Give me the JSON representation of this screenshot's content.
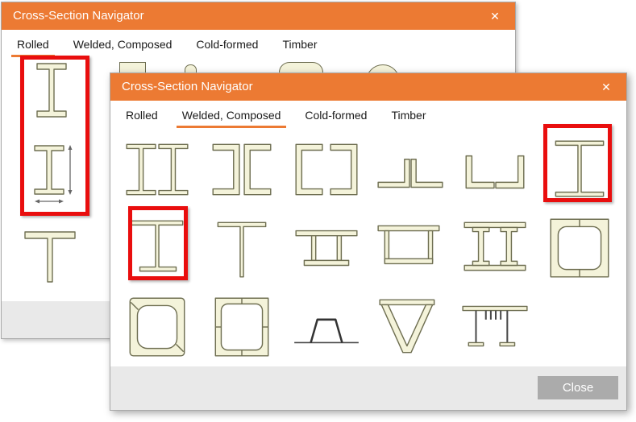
{
  "colors": {
    "titlebar": "#EC7A33",
    "tab_underline": "#EC7A33",
    "annotation": "#E90E0E",
    "shape_fill": "#F4F3DA",
    "shape_stroke": "#6F6F52",
    "dim_line": "#666666",
    "dark_line": "#4A4A4A",
    "footer_bg": "#E9E9E9",
    "close_button_bg": "#ABABAB"
  },
  "back_window": {
    "title": "Cross-Section Navigator",
    "close_icon": "✕",
    "tabs": [
      {
        "label": "Rolled",
        "selected": true
      },
      {
        "label": "Welded, Composed",
        "selected": false
      },
      {
        "label": "Cold-formed",
        "selected": false
      },
      {
        "label": "Timber",
        "selected": false
      }
    ],
    "visible_shapes": [
      {
        "name": "rolled-i-section",
        "highlighted": true
      },
      {
        "name": "rolled-i-section-with-dimension-arrows",
        "highlighted": true
      },
      {
        "name": "rolled-t-section",
        "highlighted": false
      }
    ],
    "partial_shapes": [
      "box-section-top",
      "rail-section-top",
      "rounded-tube-top",
      "round-tube-top"
    ]
  },
  "front_window": {
    "title": "Cross-Section Navigator",
    "close_icon": "✕",
    "tabs": [
      {
        "label": "Rolled",
        "selected": false
      },
      {
        "label": "Welded, Composed",
        "selected": true
      },
      {
        "label": "Cold-formed",
        "selected": false
      },
      {
        "label": "Timber",
        "selected": false
      }
    ],
    "grid": [
      [
        {
          "name": "double-i-beams",
          "highlighted": false
        },
        {
          "name": "channels-back-to-back",
          "highlighted": false
        },
        {
          "name": "channels-facing",
          "highlighted": false
        },
        {
          "name": "double-angles-back-to-back",
          "highlighted": false
        },
        {
          "name": "angles-toe-to-toe",
          "highlighted": false
        },
        {
          "name": "welded-i-section",
          "highlighted": true
        }
      ],
      [
        {
          "name": "welded-i-section-asymmetric",
          "highlighted": true
        },
        {
          "name": "welded-t-section",
          "highlighted": false
        },
        {
          "name": "double-web-plated-section",
          "highlighted": false
        },
        {
          "name": "box-with-top-plate",
          "highlighted": false
        },
        {
          "name": "double-i-with-cover-plates",
          "highlighted": false
        },
        {
          "name": "welded-box-rounded",
          "highlighted": false
        }
      ],
      [
        {
          "name": "box-from-angles",
          "highlighted": false
        },
        {
          "name": "box-from-plates",
          "highlighted": false
        },
        {
          "name": "hat-profile",
          "highlighted": false
        },
        {
          "name": "v-section",
          "highlighted": false
        },
        {
          "name": "ribbed-plate",
          "highlighted": false
        },
        {
          "name": "empty",
          "highlighted": false
        }
      ]
    ],
    "close_button_label": "Close"
  }
}
